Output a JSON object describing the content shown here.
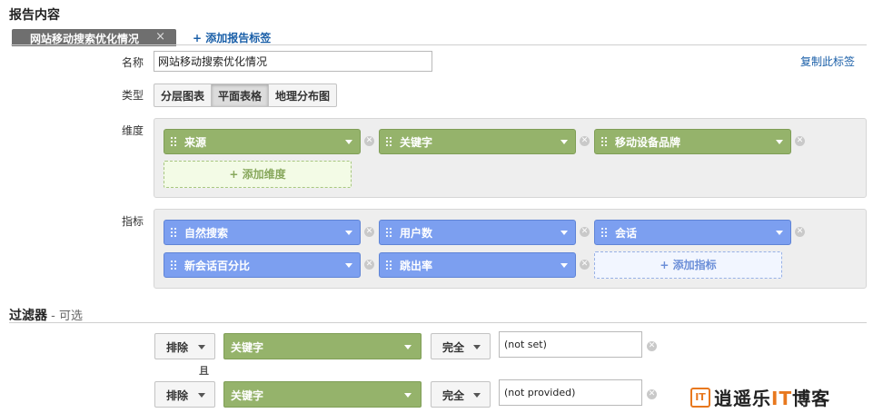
{
  "report": {
    "section_title": "报告内容",
    "tab_label": "网站移动搜索优化情况",
    "tab_close": "×",
    "add_tab": "+ 添加报告标签",
    "copy_tab": "复制此标签"
  },
  "name_field": {
    "label": "名称",
    "value": "网站移动搜索优化情况"
  },
  "type_field": {
    "label": "类型",
    "options": [
      "分层图表",
      "平面表格",
      "地理分布图"
    ],
    "selected": "平面表格"
  },
  "dimensions": {
    "label": "维度",
    "items": [
      "来源",
      "关键字",
      "移动设备品牌"
    ],
    "add_label": "+ 添加维度"
  },
  "metrics": {
    "label": "指标",
    "items": [
      "自然搜索",
      "用户数",
      "会话",
      "新会话百分比",
      "跳出率"
    ],
    "add_label": "+ 添加指标"
  },
  "filters": {
    "section_title": "过滤器",
    "optional": " - 可选",
    "and_label": "且",
    "rows": [
      {
        "action": "排除",
        "dimension": "关键字",
        "match": "完全",
        "value": "(not set)"
      },
      {
        "action": "排除",
        "dimension": "关键字",
        "match": "完全",
        "value": "(not provided)"
      }
    ]
  },
  "watermark": {
    "logo": "IT",
    "text_part1": "逍遥乐",
    "text_it": "IT",
    "text_part2": "博客"
  },
  "colors": {
    "dimension_green": "#95b36b",
    "metric_blue": "#7c9ff0",
    "link_blue": "#1a5fa8"
  }
}
